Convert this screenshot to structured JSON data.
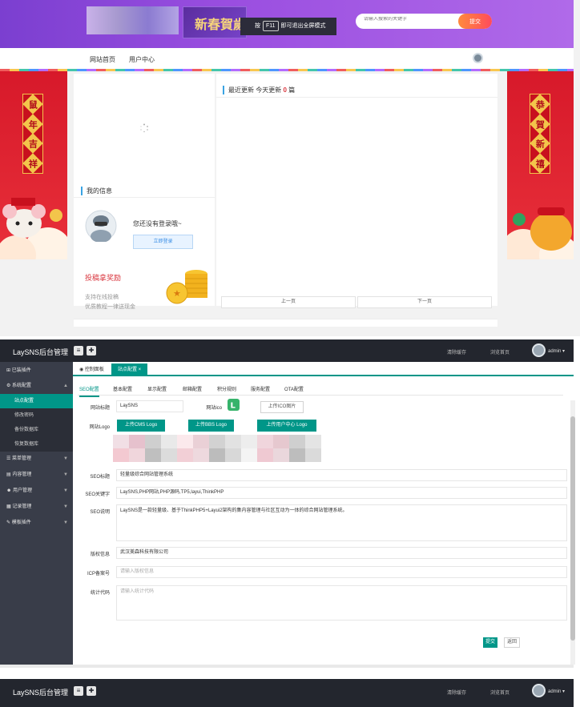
{
  "front": {
    "banner": {
      "new_year_text": "新春賀歲",
      "f11_tip_prefix": "按",
      "f11_key": "F11",
      "f11_tip_suffix": "即可退出全屏模式",
      "search_placeholder": "请输入搜索的关键字",
      "search_button": "提交"
    },
    "nav": {
      "items": [
        "网站首页",
        "用户中心"
      ]
    },
    "left_banner_chars": [
      "鼠",
      "年",
      "吉",
      "祥"
    ],
    "right_banner_chars": [
      "恭",
      "賀",
      "新",
      "禧"
    ],
    "my_info": {
      "title": "我的信息",
      "not_logged_in": "您还没有登录哦~",
      "login_button": "立即登录"
    },
    "reward": {
      "title": "投稿拿奖励",
      "line1": "支持在线投稿",
      "line2": "优质教程一律送现金"
    },
    "latest": {
      "prefix": "最近更新 今天更新",
      "count": "0",
      "suffix": "篇"
    },
    "pager": {
      "prev": "上一页",
      "next": "下一页"
    }
  },
  "admin": {
    "brand": "LaySNS后台管理",
    "header_links": [
      "清除缓存",
      "浏览首页"
    ],
    "user": "admin ▾",
    "sidebar": [
      {
        "label": "已装插件",
        "icon": "plugin-icon"
      },
      {
        "label": "系统配置",
        "icon": "settings-icon",
        "expanded": true,
        "children": [
          "站点配置",
          "修改密码",
          "备份数据库",
          "恢复数据库"
        ]
      },
      {
        "label": "菜单管理",
        "icon": "menu-icon"
      },
      {
        "label": "内容管理",
        "icon": "content-icon"
      },
      {
        "label": "用户管理",
        "icon": "users-icon"
      },
      {
        "label": "记录管理",
        "icon": "records-icon"
      },
      {
        "label": "模板插件",
        "icon": "template-icon"
      }
    ],
    "active_sub": "站点配置",
    "page_tabs": [
      "控制面板",
      "站点配置 ×"
    ],
    "config_tabs": [
      "SEO配置",
      "基本配置",
      "显示配置",
      "邮箱配置",
      "积分规则",
      "服务配置",
      "OTA配置"
    ],
    "form": {
      "site_title_label": "网站标题",
      "site_title_value": "LaySNS",
      "site_ico_label": "网站ico",
      "upload_ico": "上传ICO图片",
      "logo_label": "网站Logo",
      "upload_cms_logo": "上传CMS Logo",
      "upload_bbs_logo": "上传BBS Logo",
      "upload_user_logo": "上传用户中心 Logo",
      "seo_title_label": "SEO标题",
      "seo_title_value": "轻量级综合网站管理系统",
      "seo_keywords_label": "SEO关键字",
      "seo_keywords_value": "LaySNS,PHP网站,PHP源码,TP5,layui,ThinkPHP",
      "seo_desc_label": "SEO说明",
      "seo_desc_value": "LaySNS是一款轻量级、基于ThinkPHP5+Layui2架构的集内容管理与社区互动为一体的综合网站管理系统。",
      "copyright_label": "版权信息",
      "copyright_value": "武汉美森科技有限公司",
      "icp_label": "ICP备案号",
      "icp_placeholder": "请输入版权信息",
      "stats_label": "统计代码",
      "stats_placeholder": "请输入统计代码",
      "submit": "提交",
      "back": "返回"
    }
  },
  "admin2": {
    "brand": "LaySNS后台管理",
    "header_links": [
      "清除缓存",
      "浏览首页"
    ],
    "user": "admin ▾"
  }
}
